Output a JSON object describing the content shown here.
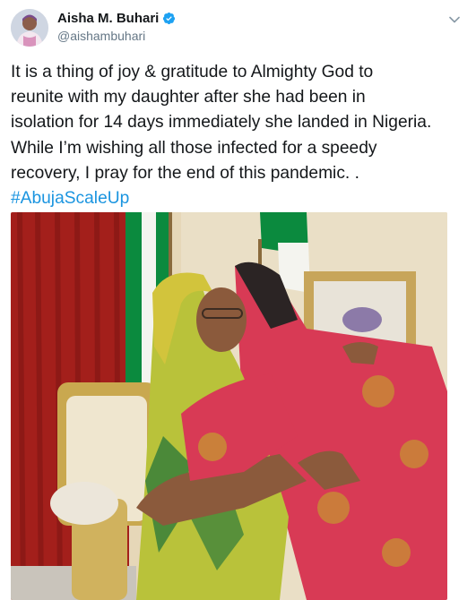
{
  "author": {
    "display_name": "Aisha M. Buhari",
    "handle": "@aishambuhari",
    "verified_icon": "verified-badge-icon",
    "avatar_icon": "profile-avatar"
  },
  "tweet": {
    "text": "It is a thing of joy & gratitude to Almighty God to\nreunite with my daughter after she had been in\nisolation for 14 days immediately she landed in Nigeria.\nWhile I’m wishing all those infected for a speedy\nrecovery, I pray for the end of this pandemic. .\n",
    "hashtag": "#AbujaScaleUp"
  },
  "menu": {
    "icon": "chevron-down-icon"
  },
  "colors": {
    "link": "#1b95e0",
    "verified": "#1da1f2",
    "handle": "#657786",
    "text": "#14171a"
  }
}
